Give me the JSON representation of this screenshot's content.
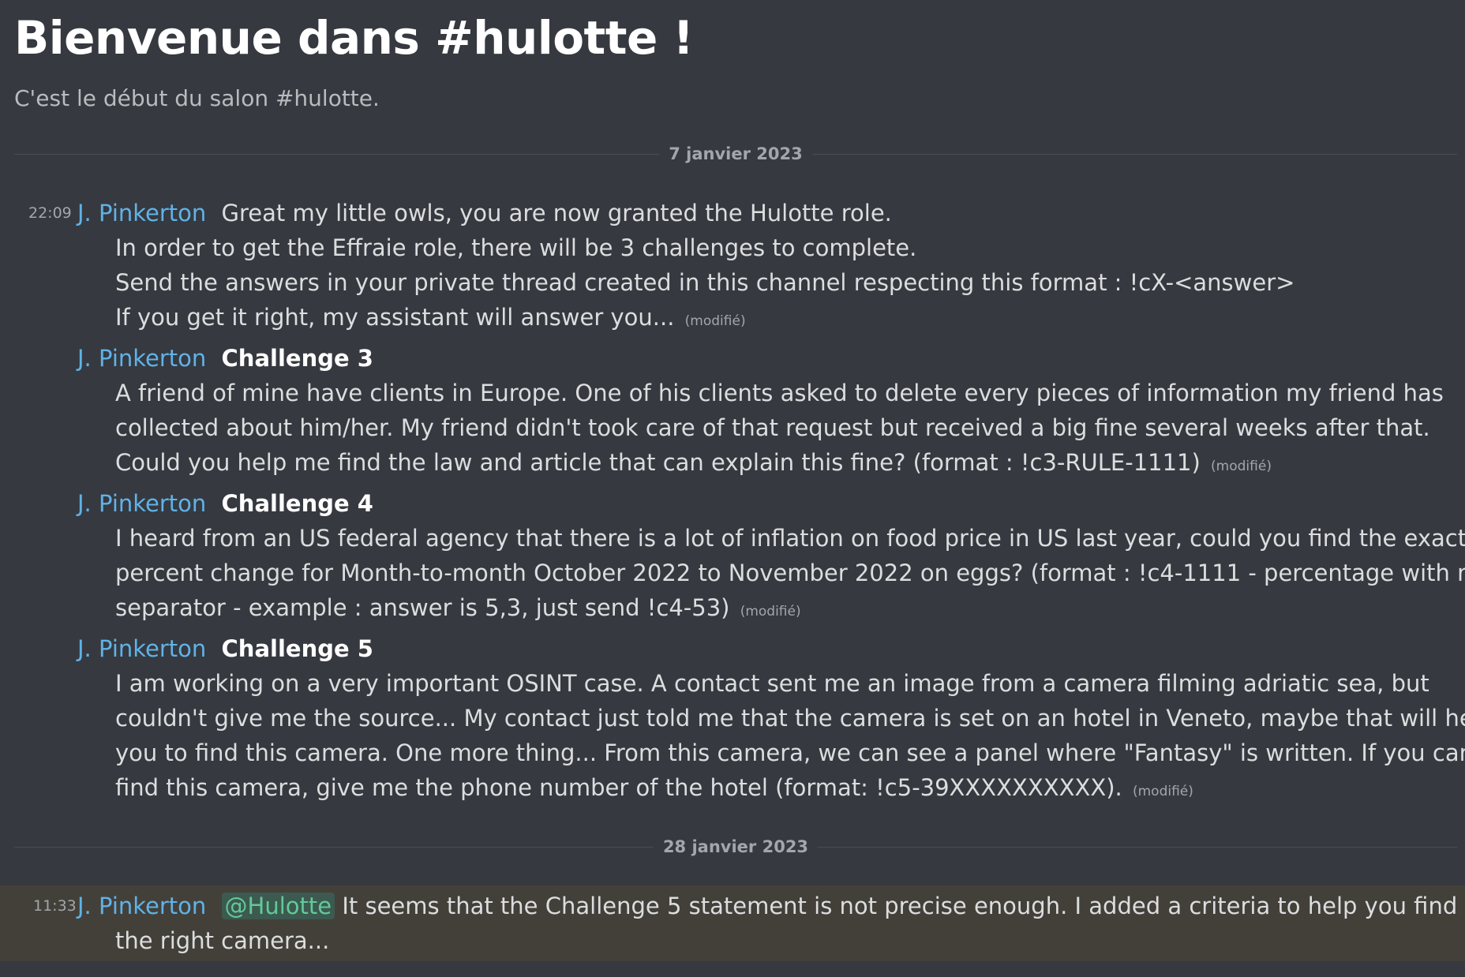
{
  "channel": {
    "welcome_title": "Bienvenue dans #hulotte !",
    "welcome_subtitle": "C'est le début du salon #hulotte."
  },
  "dividers": {
    "first": "7 janvier 2023",
    "second": "28 janvier 2023"
  },
  "messages": {
    "m1": {
      "time": "22:09",
      "author": "J. Pinkerton",
      "line1": "Great my little owls, you are now granted the Hulotte role.",
      "line2": "In order to get the Effraie role, there will be 3 challenges to complete.",
      "line3": "Send the answers in your private thread created in this channel respecting this format : !cX-<answer>",
      "line4": "If you get it right, my assistant will answer you...",
      "edited": "(modifié)"
    },
    "m2": {
      "author": "J. Pinkerton",
      "heading": "Challenge 3",
      "line1": "A friend of mine have clients in Europe. One of his clients asked to delete every pieces of information my friend has",
      "line2": "collected about him/her. My friend didn't took care of that request but received a big fine several weeks after that.",
      "line3": "Could you help me find the law and article that can explain this fine? (format : !c3-RULE-1111)",
      "edited": "(modifié)"
    },
    "m3": {
      "author": "J. Pinkerton",
      "heading": "Challenge 4",
      "line1": "I heard from an US federal agency that there is a lot of inflation on food price in US last year, could you find the exact",
      "line2": "percent change for Month-to-month October 2022 to November 2022 on eggs? (format : !c4-1111 - percentage with no",
      "line3": "separator - example : answer is 5,3, just send !c4-53)",
      "edited": "(modifié)"
    },
    "m4": {
      "author": "J. Pinkerton",
      "heading": "Challenge 5",
      "line1": "I am working on a very important OSINT case. A contact sent me an image from a camera filming adriatic sea, but",
      "line2": "couldn't give me the source... My contact just told me that the camera is set on an hotel in Veneto, maybe that will help",
      "line3": "you to find this camera. One more thing... From this camera, we can see a panel where \"Fantasy\" is written. If you can",
      "line4": "find this camera, give me the phone number of the hotel (format: !c5-39XXXXXXXXXX).",
      "edited": "(modifié)"
    },
    "m5": {
      "time": "11:33",
      "author": "J. Pinkerton",
      "mention": "@Hulotte",
      "line1": "It seems that the Challenge 5 statement is not precise enough. I added a criteria to help you find",
      "line2": "the right camera..."
    }
  }
}
